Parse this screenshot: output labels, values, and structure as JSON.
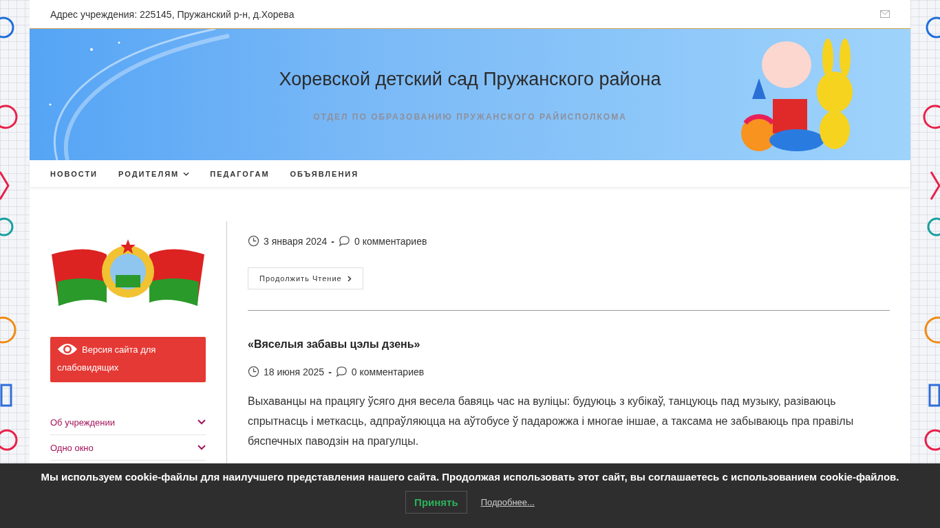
{
  "top_bar": {
    "address": "Адрес учреждения: 225145, Пружанский р-н, д.Хорева"
  },
  "header": {
    "title": "Хоревской детский сад Пружанского района",
    "subtitle": "ОТДЕЛ ПО ОБРАЗОВАНИЮ ПРУЖАНСКОГО РАЙИСПОЛКОМА"
  },
  "nav": [
    {
      "label": "НОВОСТИ",
      "submenu": false
    },
    {
      "label": "РОДИТЕЛЯМ",
      "submenu": true
    },
    {
      "label": "ПЕДАГОГАМ",
      "submenu": false
    },
    {
      "label": "ОБЪЯВЛЕНИЯ",
      "submenu": false
    }
  ],
  "sidebar": {
    "accessibility_button": "Версия сайта для слабовидящих",
    "menu": [
      {
        "label": "Об учреждении",
        "expandable": true
      },
      {
        "label": "Одно окно",
        "expandable": true
      }
    ]
  },
  "posts": [
    {
      "date": "3 января 2024",
      "separator": "-",
      "comments": "0 комментариев",
      "read_more": "Продолжить Чтение"
    },
    {
      "title": "«Вяселыя забавы цэлы дзень»",
      "date": "18 июня 2025",
      "separator": "-",
      "comments": "0 комментариев",
      "excerpt": "Выхаванцы на працягу ўсяго дня весела бавяць час на вуліцы: будуюць з кубікаў, танцуюць пад музыку, разіваюць спрытнасць і меткасць, адпраўляюцца на аўтобусе ў падарожжа і многае іншае, а таксама не забываюць пра правілы бяспечных паводзін на прагулцы."
    }
  ],
  "cookie_bar": {
    "message": "Мы используем cookie-файлы для наилучшего представления нашего сайта. Продолжая использовать этот сайт, вы соглашаетесь с использованием cookie-файлов.",
    "accept": "Принять",
    "more": "Подробнее..."
  }
}
